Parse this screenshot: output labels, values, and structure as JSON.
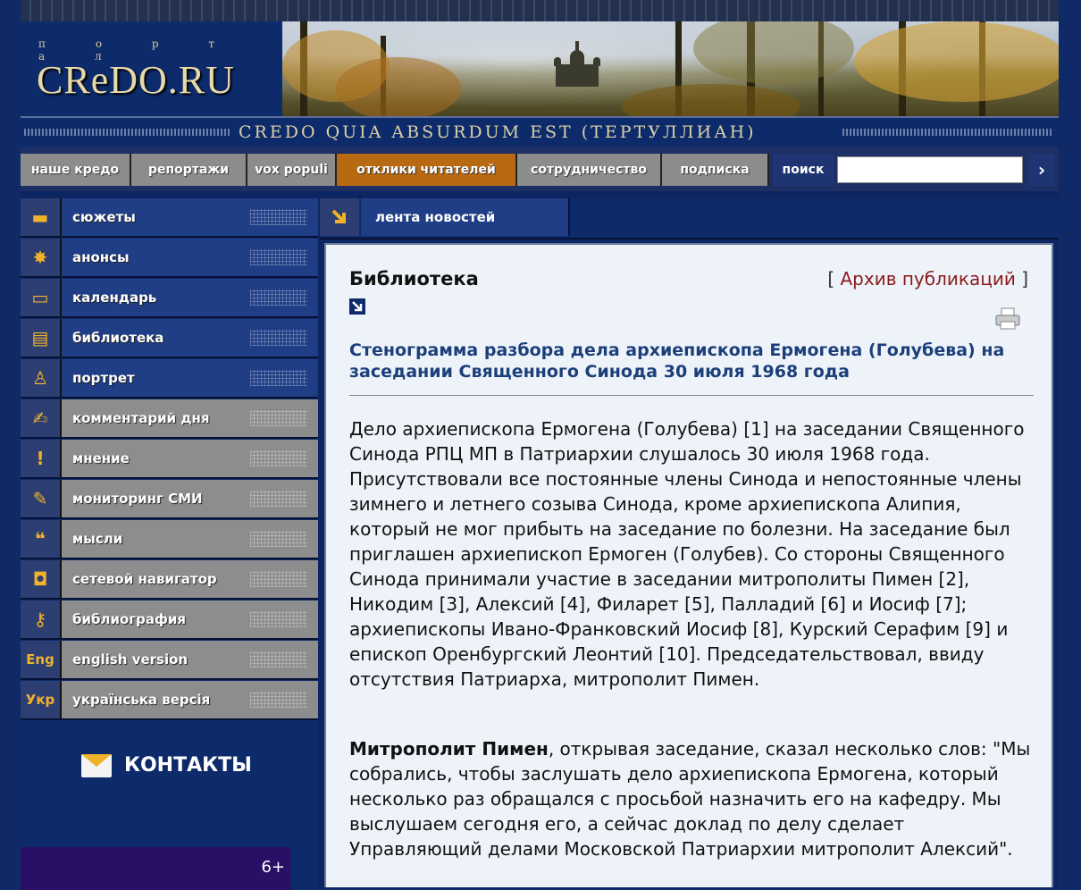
{
  "header": {
    "portal_label": "п о р т а л",
    "logo_name": "CReDO.RU",
    "motto": "CREDO QUIA ABSURDUM EST (ТЕРТУЛЛИАН)"
  },
  "topnav": {
    "items": [
      {
        "label": "наше кредо"
      },
      {
        "label": "репортажи"
      },
      {
        "label": "vox populi"
      },
      {
        "label": "отклики читателей",
        "active": true
      },
      {
        "label": "сотрудничество"
      },
      {
        "label": "подписка"
      }
    ],
    "search_label": "поиск",
    "search_value": "",
    "go_symbol": "›"
  },
  "sidebar": {
    "items": [
      {
        "label": "сюжеты",
        "icon": "camera-icon",
        "glyph": "▬"
      },
      {
        "label": "анонсы",
        "icon": "star-burst-icon",
        "glyph": "✸"
      },
      {
        "label": "календарь",
        "icon": "folder-icon",
        "glyph": "▭"
      },
      {
        "label": "библиотека",
        "icon": "books-icon",
        "glyph": "▤"
      },
      {
        "label": "портрет",
        "icon": "person-icon",
        "glyph": "♙"
      },
      {
        "label": "комментарий дня",
        "icon": "pen-icon",
        "glyph": "✍"
      },
      {
        "label": "мнение",
        "icon": "exclamation-icon",
        "glyph": "!"
      },
      {
        "label": "мониторинг СМИ",
        "icon": "pencil-icon",
        "glyph": "✎"
      },
      {
        "label": "мысли",
        "icon": "speech-bubble-icon",
        "glyph": "❝"
      },
      {
        "label": "сетевой навигатор",
        "icon": "mouse-icon",
        "glyph": "◘"
      },
      {
        "label": "библиография",
        "icon": "key-icon",
        "glyph": "⚷"
      },
      {
        "label": "english version",
        "icon": "eng-icon",
        "text": "Eng"
      },
      {
        "label": "українська версія",
        "icon": "ukr-icon",
        "text": "Укр"
      }
    ],
    "contacts_label": "КОНТАКТЫ",
    "age_rating": "6+"
  },
  "newsbar": {
    "label": "лента новостей"
  },
  "content": {
    "section_title": "Библиотека",
    "archive_open": "[",
    "archive_link": "Архив публикаций",
    "archive_close": "]",
    "headline": "Стенограмма разбора дела архиепископа Ермогена (Голубева) на заседании Священного Синода 30 июля 1968 года",
    "paragraph1": "Дело архиепископа Ермогена (Голубева) [1] на заседании Священного Синода РПЦ МП в Патриархии слушалось 30 июля 1968 года. Присутствовали все постоянные члены Синода и непостоянные члены зимнего и летнего созыва Синода, кроме архиепископа Алипия, который не мог прибыть на заседание по болезни. На заседание был приглашен архиепископ Ермоген (Голубев). Со стороны Священного Синода принимали участие в заседании митрополиты Пимен [2], Никодим [3], Алексий [4], Филарет [5], Палладий [6] и Иосиф [7]; архиепископы Ивано-Франковский Иосиф [8], Курский Серафим [9] и епископ Оренбургский Леонтий [10]. Председательствовал, ввиду отсутствия Патриарха, митрополит Пимен.",
    "paragraph2_bold": "Митрополит Пимен",
    "paragraph2_rest": ", открывая заседание, сказал несколько слов: \"Мы собрались, чтобы заслушать дело архиепископа Ермогена, который несколько раз обращался с просьбой назначить его на кафедру. Мы выслушаем сегодня его, а сейчас доклад по делу сделает Управляющий делами Московской Патриархии митрополит Алексий\"."
  },
  "colors": {
    "background": "#0d2560",
    "nav_grey": "#8c8c8c",
    "nav_active": "#b86a12",
    "side_blue": "#1f3e86",
    "headline": "#1c3f7a",
    "archive_link": "#8a1a1a",
    "icon_accent": "#f0b22a"
  }
}
